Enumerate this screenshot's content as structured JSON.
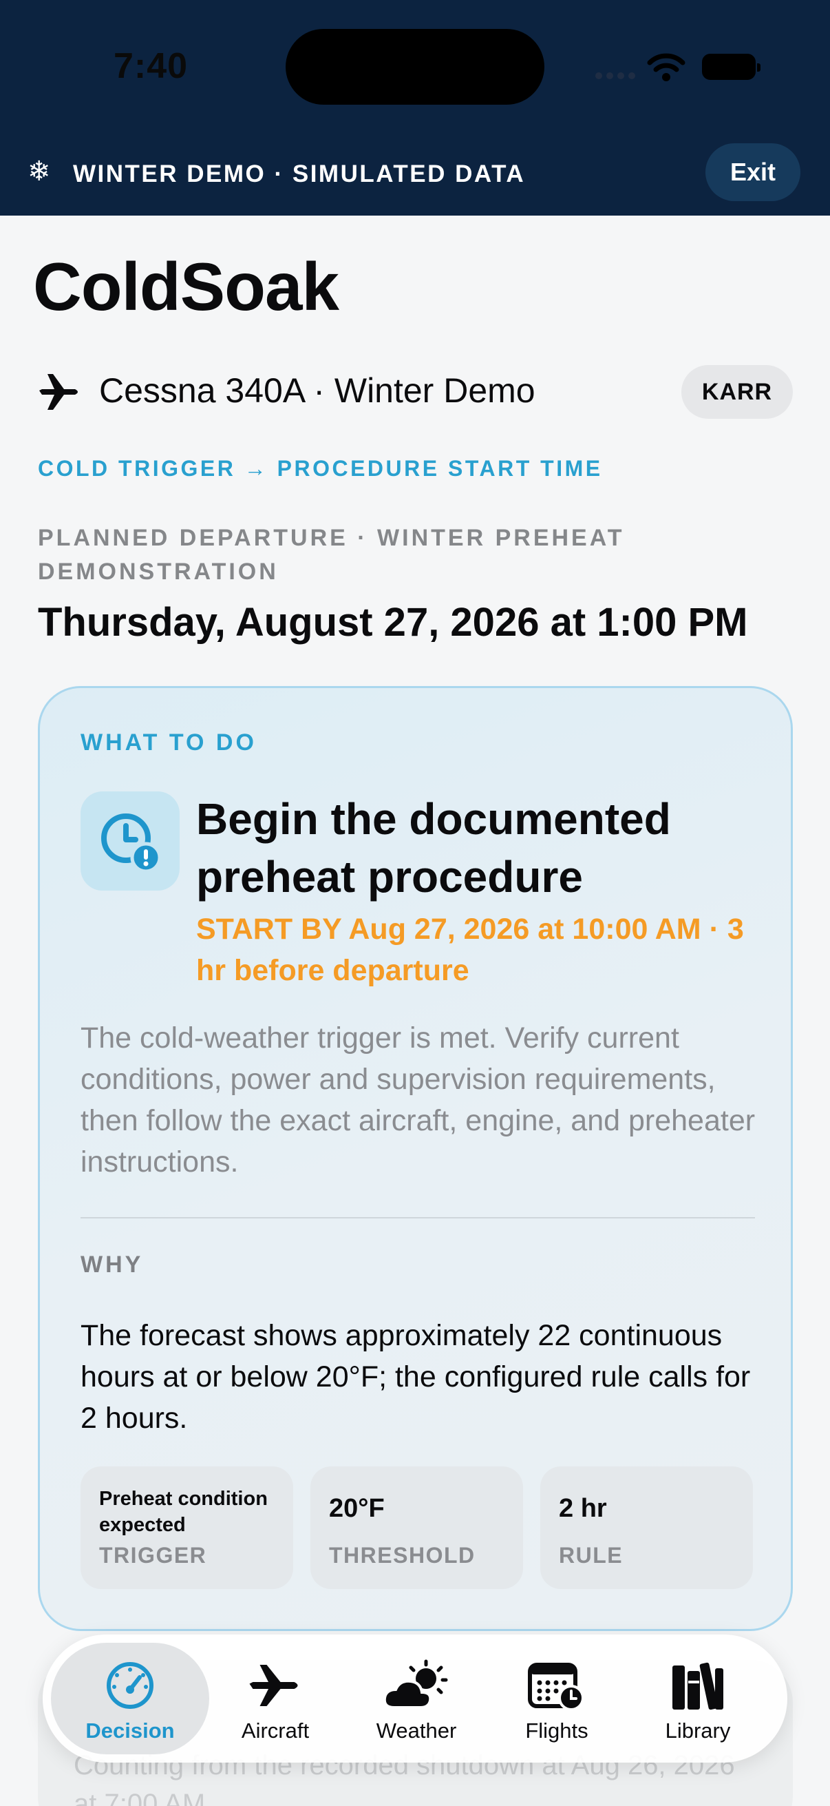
{
  "status_bar": {
    "time": "7:40"
  },
  "banner": {
    "icon": "snowflake-icon",
    "text": "WINTER DEMO · SIMULATED DATA",
    "exit_label": "Exit"
  },
  "app": {
    "title": "ColdSoak"
  },
  "aircraft": {
    "icon": "airplane-icon",
    "name": "Cessna 340A · Winter Demo",
    "airport": "KARR"
  },
  "trigger_label": "COLD TRIGGER → PROCEDURE START TIME",
  "departure": {
    "label": "PLANNED DEPARTURE · WINTER PREHEAT DEMONSTRATION",
    "time": "Thursday, August 27, 2026 at 1:00 PM"
  },
  "card": {
    "label": "WHAT TO DO",
    "icon": "clock-alert-icon",
    "title": "Begin the documented preheat procedure",
    "start_by": "START BY Aug 27, 2026 at 10:00 AM · 3 hr before departure",
    "instructions": "The cold-weather trigger is met. Verify current conditions, power and supervision requirements, then follow the exact aircraft, engine, and preheater instructions.",
    "why_label": "WHY",
    "why_text": "The forecast shows approximately 22 continuous hours at or below 20°F; the configured rule calls for 2 hours.",
    "stats": [
      {
        "value": "Preheat condition expected",
        "key": "TRIGGER"
      },
      {
        "value": "20°F",
        "key": "THRESHOLD"
      },
      {
        "value": "2 hr",
        "key": "RULE"
      }
    ]
  },
  "next_card": {
    "text": "Counting from the recorded shutdown at Aug 26, 2026 at 7:00 AM"
  },
  "tabs": [
    {
      "label": "Decision",
      "icon": "gauge-icon",
      "active": true
    },
    {
      "label": "Aircraft",
      "icon": "airplane-icon",
      "active": false
    },
    {
      "label": "Weather",
      "icon": "cloud-sun-icon",
      "active": false
    },
    {
      "label": "Flights",
      "icon": "calendar-clock-icon",
      "active": false
    },
    {
      "label": "Library",
      "icon": "books-icon",
      "active": false
    }
  ],
  "colors": {
    "banner_bg": "#0c2340",
    "accent_blue": "#29a0cf",
    "accent_orange": "#f59b25"
  }
}
